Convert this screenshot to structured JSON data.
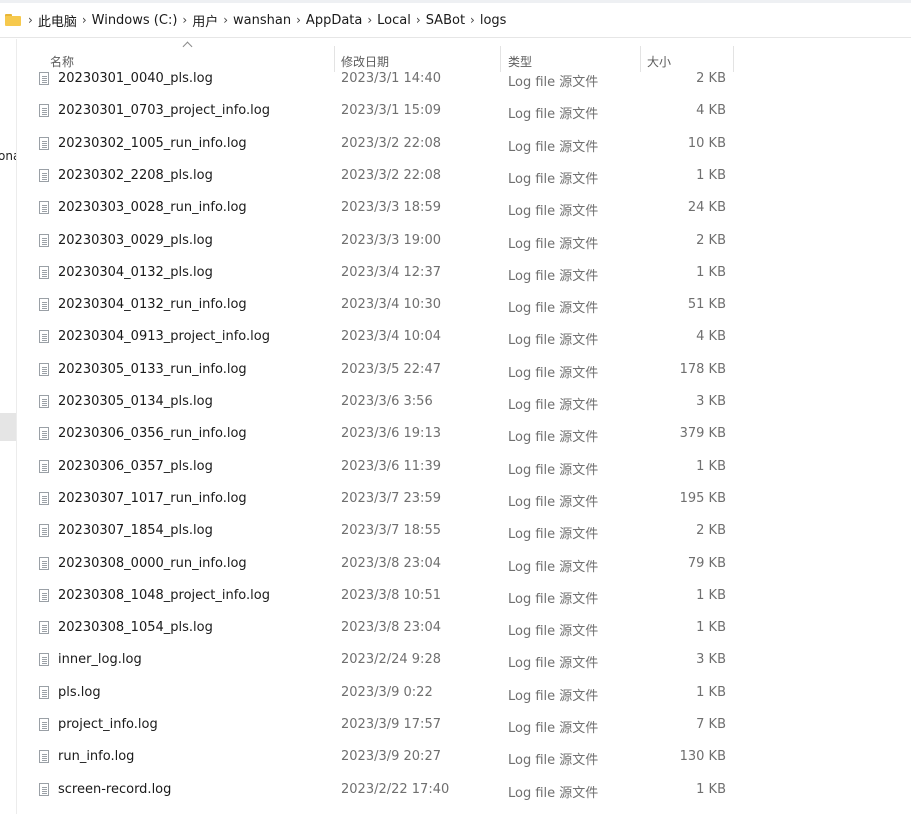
{
  "breadcrumb": [
    "此电脑",
    "Windows (C:)",
    "用户",
    "wanshan",
    "AppData",
    "Local",
    "SABot",
    "logs"
  ],
  "nav": {
    "clipped_label": "ona"
  },
  "columns": {
    "name": "名称",
    "date": "修改日期",
    "type": "类型",
    "size": "大小"
  },
  "files": [
    {
      "name": "20230301_0040_pls.log",
      "date": "2023/3/1 14:40",
      "type": "Log file 源文件",
      "size": "2 KB"
    },
    {
      "name": "20230301_0703_project_info.log",
      "date": "2023/3/1 15:09",
      "type": "Log file 源文件",
      "size": "4 KB"
    },
    {
      "name": "20230302_1005_run_info.log",
      "date": "2023/3/2 22:08",
      "type": "Log file 源文件",
      "size": "10 KB"
    },
    {
      "name": "20230302_2208_pls.log",
      "date": "2023/3/2 22:08",
      "type": "Log file 源文件",
      "size": "1 KB"
    },
    {
      "name": "20230303_0028_run_info.log",
      "date": "2023/3/3 18:59",
      "type": "Log file 源文件",
      "size": "24 KB"
    },
    {
      "name": "20230303_0029_pls.log",
      "date": "2023/3/3 19:00",
      "type": "Log file 源文件",
      "size": "2 KB"
    },
    {
      "name": "20230304_0132_pls.log",
      "date": "2023/3/4 12:37",
      "type": "Log file 源文件",
      "size": "1 KB"
    },
    {
      "name": "20230304_0132_run_info.log",
      "date": "2023/3/4 10:30",
      "type": "Log file 源文件",
      "size": "51 KB"
    },
    {
      "name": "20230304_0913_project_info.log",
      "date": "2023/3/4 10:04",
      "type": "Log file 源文件",
      "size": "4 KB"
    },
    {
      "name": "20230305_0133_run_info.log",
      "date": "2023/3/5 22:47",
      "type": "Log file 源文件",
      "size": "178 KB"
    },
    {
      "name": "20230305_0134_pls.log",
      "date": "2023/3/6 3:56",
      "type": "Log file 源文件",
      "size": "3 KB"
    },
    {
      "name": "20230306_0356_run_info.log",
      "date": "2023/3/6 19:13",
      "type": "Log file 源文件",
      "size": "379 KB"
    },
    {
      "name": "20230306_0357_pls.log",
      "date": "2023/3/6 11:39",
      "type": "Log file 源文件",
      "size": "1 KB"
    },
    {
      "name": "20230307_1017_run_info.log",
      "date": "2023/3/7 23:59",
      "type": "Log file 源文件",
      "size": "195 KB"
    },
    {
      "name": "20230307_1854_pls.log",
      "date": "2023/3/7 18:55",
      "type": "Log file 源文件",
      "size": "2 KB"
    },
    {
      "name": "20230308_0000_run_info.log",
      "date": "2023/3/8 23:04",
      "type": "Log file 源文件",
      "size": "79 KB"
    },
    {
      "name": "20230308_1048_project_info.log",
      "date": "2023/3/8 10:51",
      "type": "Log file 源文件",
      "size": "1 KB"
    },
    {
      "name": "20230308_1054_pls.log",
      "date": "2023/3/8 23:04",
      "type": "Log file 源文件",
      "size": "1 KB"
    },
    {
      "name": "inner_log.log",
      "date": "2023/2/24 9:28",
      "type": "Log file 源文件",
      "size": "3 KB"
    },
    {
      "name": "pls.log",
      "date": "2023/3/9 0:22",
      "type": "Log file 源文件",
      "size": "1 KB"
    },
    {
      "name": "project_info.log",
      "date": "2023/3/9 17:57",
      "type": "Log file 源文件",
      "size": "7 KB"
    },
    {
      "name": "run_info.log",
      "date": "2023/3/9 20:27",
      "type": "Log file 源文件",
      "size": "130 KB"
    },
    {
      "name": "screen-record.log",
      "date": "2023/2/22 17:40",
      "type": "Log file 源文件",
      "size": "1 KB"
    }
  ]
}
